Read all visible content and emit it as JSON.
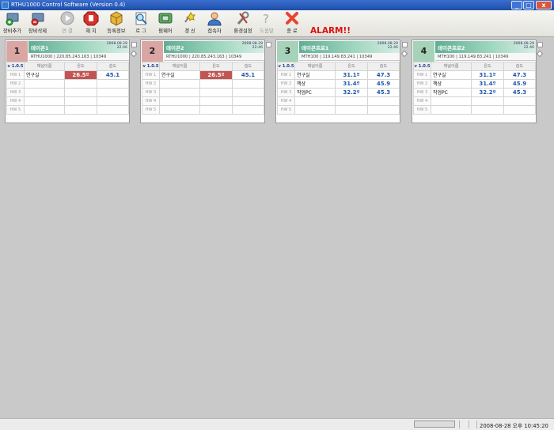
{
  "window": {
    "title": "RTHU1000 Control Software (Version 0.4)"
  },
  "toolbar": {
    "buttons": [
      {
        "label": "장비추가",
        "icon": "add-device-icon"
      },
      {
        "label": "장비삭제",
        "icon": "delete-device-icon"
      },
      {
        "label": "연 결",
        "icon": "connect-icon"
      },
      {
        "label": "해 지",
        "icon": "disconnect-icon"
      },
      {
        "label": "등록정보",
        "icon": "properties-icon"
      },
      {
        "label": "로 그",
        "icon": "log-icon"
      },
      {
        "label": "펌웨어",
        "icon": "firmware-icon"
      },
      {
        "label": "갱 신",
        "icon": "refresh-icon"
      },
      {
        "label": "접속자",
        "icon": "user-icon"
      },
      {
        "label": "환경설정",
        "icon": "settings-icon"
      },
      {
        "label": "도움말",
        "icon": "help-icon"
      },
      {
        "label": "종 료",
        "icon": "exit-icon"
      }
    ],
    "alarm": "ALARM!!"
  },
  "panels": [
    {
      "number": "1",
      "name": "데이콘1",
      "date": "2008.08.28",
      "time": "22:46",
      "info": "RTHU1000 | 220.85.243.163 | 10349",
      "header": [
        "v 1.0.5",
        "채널이름",
        "온도",
        "습도"
      ],
      "rows": [
        {
          "hw": "HW 1",
          "name": "연구실",
          "temp": "26.5º",
          "hum": "45.1",
          "alert": true
        },
        {
          "hw": "HW 2",
          "name": "",
          "temp": "",
          "hum": "",
          "alert": false
        },
        {
          "hw": "HW 3",
          "name": "",
          "temp": "",
          "hum": "",
          "alert": false
        },
        {
          "hw": "HW 4",
          "name": "",
          "temp": "",
          "hum": "",
          "alert": false
        },
        {
          "hw": "HW 5",
          "name": "",
          "temp": "",
          "hum": "",
          "alert": false
        }
      ]
    },
    {
      "number": "2",
      "name": "데이콘2",
      "date": "2008.08.28",
      "time": "22:46",
      "info": "RTHU1000 | 220.85.243.163 | 10349",
      "header": [
        "v 1.0.5",
        "채널이름",
        "온도",
        "습도"
      ],
      "rows": [
        {
          "hw": "HW 1",
          "name": "연구실",
          "temp": "26.5º",
          "hum": "45.1",
          "alert": true
        },
        {
          "hw": "HW 2",
          "name": "",
          "temp": "",
          "hum": "",
          "alert": false
        },
        {
          "hw": "HW 3",
          "name": "",
          "temp": "",
          "hum": "",
          "alert": false
        },
        {
          "hw": "HW 4",
          "name": "",
          "temp": "",
          "hum": "",
          "alert": false
        },
        {
          "hw": "HW 5",
          "name": "",
          "temp": "",
          "hum": "",
          "alert": false
        }
      ]
    },
    {
      "number": "3",
      "name": "데이콘프로1",
      "date": "2008.08.28",
      "time": "22:46",
      "info": "MTH100 | 119.149.83.241 | 10349",
      "header": [
        "v 1.0.5",
        "채널이름",
        "온도",
        "습도"
      ],
      "rows": [
        {
          "hw": "HW 1",
          "name": "연구실",
          "temp": "31.1º",
          "hum": "47.3",
          "alert": false
        },
        {
          "hw": "HW 2",
          "name": "책상",
          "temp": "31.4º",
          "hum": "45.9",
          "alert": false
        },
        {
          "hw": "HW 3",
          "name": "작업PC",
          "temp": "32.2º",
          "hum": "45.3",
          "alert": false
        },
        {
          "hw": "HW 4",
          "name": "",
          "temp": "",
          "hum": "",
          "alert": false
        },
        {
          "hw": "HW 5",
          "name": "",
          "temp": "",
          "hum": "",
          "alert": false
        }
      ]
    },
    {
      "number": "4",
      "name": "데이콘프로2",
      "date": "2008.08.28",
      "time": "22:46",
      "info": "MTH100 | 119.149.83.241 | 10349",
      "header": [
        "v 1.0.5",
        "채널이름",
        "온도",
        "습도"
      ],
      "rows": [
        {
          "hw": "HW 1",
          "name": "연구실",
          "temp": "31.1º",
          "hum": "47.3",
          "alert": false
        },
        {
          "hw": "HW 2",
          "name": "책상",
          "temp": "31.4º",
          "hum": "45.9",
          "alert": false
        },
        {
          "hw": "HW 3",
          "name": "작업PC",
          "temp": "32.2º",
          "hum": "45.3",
          "alert": false
        },
        {
          "hw": "HW 4",
          "name": "",
          "temp": "",
          "hum": "",
          "alert": false
        },
        {
          "hw": "HW 5",
          "name": "",
          "temp": "",
          "hum": "",
          "alert": false
        }
      ]
    }
  ],
  "status": {
    "datetime": "2008-08-28 오후 10:45:20"
  }
}
